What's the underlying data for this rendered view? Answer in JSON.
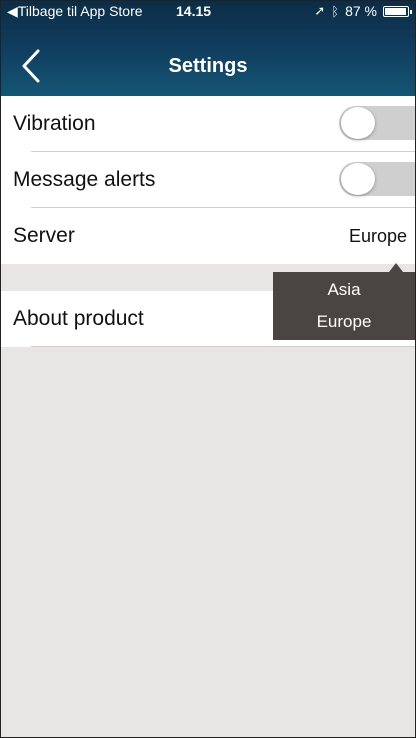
{
  "status_bar": {
    "back_label": "◀Tilbage til App Store",
    "time": "14.15",
    "battery": "87 %",
    "battery_level": 0.87,
    "icons": [
      "location-icon",
      "bluetooth-icon",
      "battery-icon"
    ]
  },
  "nav": {
    "title": "Settings",
    "back_icon": "chevron-left-icon"
  },
  "settings": {
    "vibration": {
      "label": "Vibration",
      "on": false
    },
    "message_alerts": {
      "label": "Message alerts",
      "on": false
    },
    "server": {
      "label": "Server",
      "value": "Europe"
    },
    "about": {
      "label": "About product"
    }
  },
  "server_popup": {
    "options": [
      "Asia",
      "Europe"
    ]
  },
  "colors": {
    "header_top": "#0c2d47",
    "header_bottom": "#155575",
    "background": "#e8e6e4",
    "popup": "#4a4543",
    "toggle_off": "#cfcfcf"
  }
}
